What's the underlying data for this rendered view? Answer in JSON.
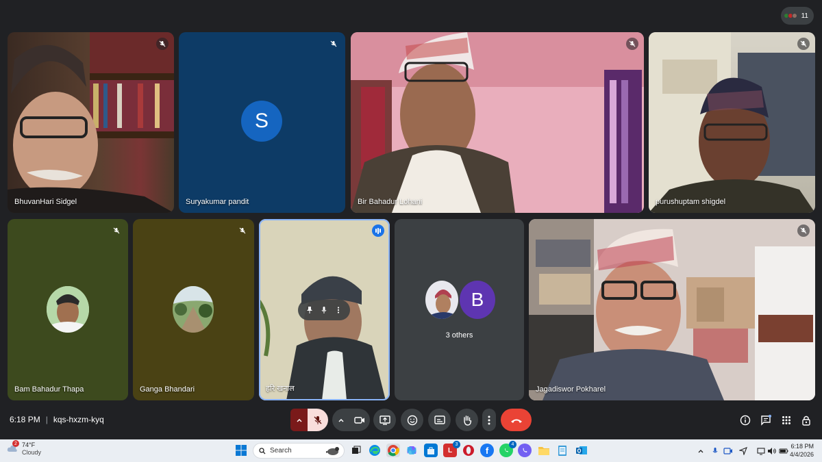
{
  "participant_count": "11",
  "tiles": [
    {
      "name": "BhuvanHari Sidgel",
      "muted": true
    },
    {
      "name": "Suryakumar pandit",
      "initial": "S",
      "muted": true
    },
    {
      "name": "Bir Bahadur Lohani",
      "muted": true
    },
    {
      "name": "purushuptam shigdel",
      "muted": true
    },
    {
      "name": "Bam Bahadur Thapa",
      "muted": true
    },
    {
      "name": "Ganga Bhandari",
      "muted": true
    },
    {
      "name": "हरि खनाल",
      "speaking": true
    },
    {
      "name": "3 others",
      "initial": "B"
    },
    {
      "name": "Jagadiswor Pokharel",
      "muted": true
    }
  ],
  "meeting": {
    "time": "6:18 PM",
    "separator": "|",
    "code": "kqs-hxzm-kyq"
  },
  "controls": [
    {
      "icon": "chevron-up-icon"
    },
    {
      "icon": "mic-off-icon",
      "state": "off"
    },
    {
      "icon": "chevron-up-icon"
    },
    {
      "icon": "camera-icon"
    },
    {
      "icon": "present-screen-icon"
    },
    {
      "icon": "emoji-icon"
    },
    {
      "icon": "captions-icon"
    },
    {
      "icon": "raise-hand-icon"
    },
    {
      "icon": "more-options-icon"
    },
    {
      "icon": "end-call-icon"
    }
  ],
  "right_controls": [
    "info-icon",
    "chat-icon",
    "activities-icon",
    "host-controls-icon"
  ],
  "taskbar": {
    "weather": {
      "badge": "2",
      "temp": "74°F",
      "condition": "Cloudy"
    },
    "search_placeholder": "Search",
    "apps": [
      "file-explorer",
      "edge",
      "chrome",
      "copilot",
      "store",
      "l-app",
      "opera",
      "facebook",
      "whatsapp",
      "viber",
      "folder",
      "notepad",
      "outlook"
    ],
    "app_badges": {
      "l_app": "3",
      "whatsapp": "4"
    },
    "clock": {
      "time": "6:18 PM",
      "date": "4/4/2026"
    }
  },
  "colors": {
    "background": "#202124",
    "tile_suryakumar": "#0d3b66",
    "avatar_s": "#1565c0",
    "avatar_b": "#5e35b1",
    "end_call": "#ea4335",
    "mic_off": "#f9dedc",
    "speaking_blue": "#1a73e8"
  }
}
